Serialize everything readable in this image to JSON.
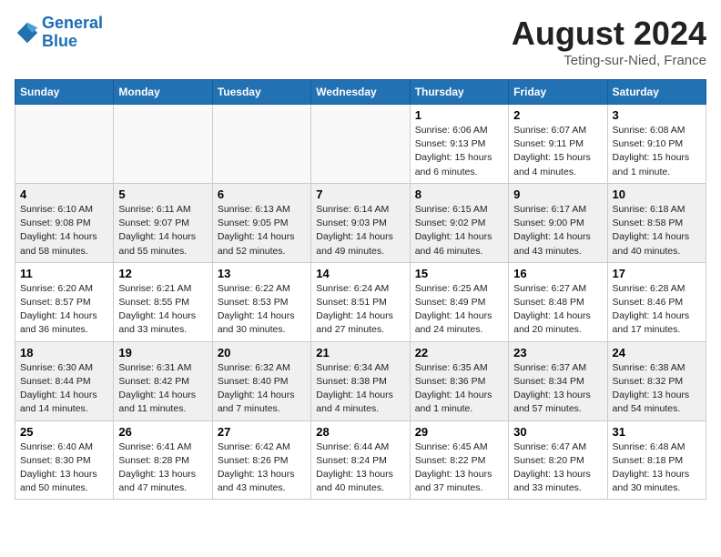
{
  "header": {
    "logo_line1": "General",
    "logo_line2": "Blue",
    "month_year": "August 2024",
    "location": "Teting-sur-Nied, France"
  },
  "days_of_week": [
    "Sunday",
    "Monday",
    "Tuesday",
    "Wednesday",
    "Thursday",
    "Friday",
    "Saturday"
  ],
  "weeks": [
    [
      {
        "day": "",
        "empty": true
      },
      {
        "day": "",
        "empty": true
      },
      {
        "day": "",
        "empty": true
      },
      {
        "day": "",
        "empty": true
      },
      {
        "day": "1",
        "sunrise": "6:06 AM",
        "sunset": "9:13 PM",
        "daylight": "15 hours and 6 minutes."
      },
      {
        "day": "2",
        "sunrise": "6:07 AM",
        "sunset": "9:11 PM",
        "daylight": "15 hours and 4 minutes."
      },
      {
        "day": "3",
        "sunrise": "6:08 AM",
        "sunset": "9:10 PM",
        "daylight": "15 hours and 1 minute."
      }
    ],
    [
      {
        "day": "4",
        "sunrise": "6:10 AM",
        "sunset": "9:08 PM",
        "daylight": "14 hours and 58 minutes."
      },
      {
        "day": "5",
        "sunrise": "6:11 AM",
        "sunset": "9:07 PM",
        "daylight": "14 hours and 55 minutes."
      },
      {
        "day": "6",
        "sunrise": "6:13 AM",
        "sunset": "9:05 PM",
        "daylight": "14 hours and 52 minutes."
      },
      {
        "day": "7",
        "sunrise": "6:14 AM",
        "sunset": "9:03 PM",
        "daylight": "14 hours and 49 minutes."
      },
      {
        "day": "8",
        "sunrise": "6:15 AM",
        "sunset": "9:02 PM",
        "daylight": "14 hours and 46 minutes."
      },
      {
        "day": "9",
        "sunrise": "6:17 AM",
        "sunset": "9:00 PM",
        "daylight": "14 hours and 43 minutes."
      },
      {
        "day": "10",
        "sunrise": "6:18 AM",
        "sunset": "8:58 PM",
        "daylight": "14 hours and 40 minutes."
      }
    ],
    [
      {
        "day": "11",
        "sunrise": "6:20 AM",
        "sunset": "8:57 PM",
        "daylight": "14 hours and 36 minutes."
      },
      {
        "day": "12",
        "sunrise": "6:21 AM",
        "sunset": "8:55 PM",
        "daylight": "14 hours and 33 minutes."
      },
      {
        "day": "13",
        "sunrise": "6:22 AM",
        "sunset": "8:53 PM",
        "daylight": "14 hours and 30 minutes."
      },
      {
        "day": "14",
        "sunrise": "6:24 AM",
        "sunset": "8:51 PM",
        "daylight": "14 hours and 27 minutes."
      },
      {
        "day": "15",
        "sunrise": "6:25 AM",
        "sunset": "8:49 PM",
        "daylight": "14 hours and 24 minutes."
      },
      {
        "day": "16",
        "sunrise": "6:27 AM",
        "sunset": "8:48 PM",
        "daylight": "14 hours and 20 minutes."
      },
      {
        "day": "17",
        "sunrise": "6:28 AM",
        "sunset": "8:46 PM",
        "daylight": "14 hours and 17 minutes."
      }
    ],
    [
      {
        "day": "18",
        "sunrise": "6:30 AM",
        "sunset": "8:44 PM",
        "daylight": "14 hours and 14 minutes."
      },
      {
        "day": "19",
        "sunrise": "6:31 AM",
        "sunset": "8:42 PM",
        "daylight": "14 hours and 11 minutes."
      },
      {
        "day": "20",
        "sunrise": "6:32 AM",
        "sunset": "8:40 PM",
        "daylight": "14 hours and 7 minutes."
      },
      {
        "day": "21",
        "sunrise": "6:34 AM",
        "sunset": "8:38 PM",
        "daylight": "14 hours and 4 minutes."
      },
      {
        "day": "22",
        "sunrise": "6:35 AM",
        "sunset": "8:36 PM",
        "daylight": "14 hours and 1 minute."
      },
      {
        "day": "23",
        "sunrise": "6:37 AM",
        "sunset": "8:34 PM",
        "daylight": "13 hours and 57 minutes."
      },
      {
        "day": "24",
        "sunrise": "6:38 AM",
        "sunset": "8:32 PM",
        "daylight": "13 hours and 54 minutes."
      }
    ],
    [
      {
        "day": "25",
        "sunrise": "6:40 AM",
        "sunset": "8:30 PM",
        "daylight": "13 hours and 50 minutes."
      },
      {
        "day": "26",
        "sunrise": "6:41 AM",
        "sunset": "8:28 PM",
        "daylight": "13 hours and 47 minutes."
      },
      {
        "day": "27",
        "sunrise": "6:42 AM",
        "sunset": "8:26 PM",
        "daylight": "13 hours and 43 minutes."
      },
      {
        "day": "28",
        "sunrise": "6:44 AM",
        "sunset": "8:24 PM",
        "daylight": "13 hours and 40 minutes."
      },
      {
        "day": "29",
        "sunrise": "6:45 AM",
        "sunset": "8:22 PM",
        "daylight": "13 hours and 37 minutes."
      },
      {
        "day": "30",
        "sunrise": "6:47 AM",
        "sunset": "8:20 PM",
        "daylight": "13 hours and 33 minutes."
      },
      {
        "day": "31",
        "sunrise": "6:48 AM",
        "sunset": "8:18 PM",
        "daylight": "13 hours and 30 minutes."
      }
    ]
  ],
  "row_classes": [
    "",
    "row-alt",
    "",
    "row-alt",
    ""
  ]
}
